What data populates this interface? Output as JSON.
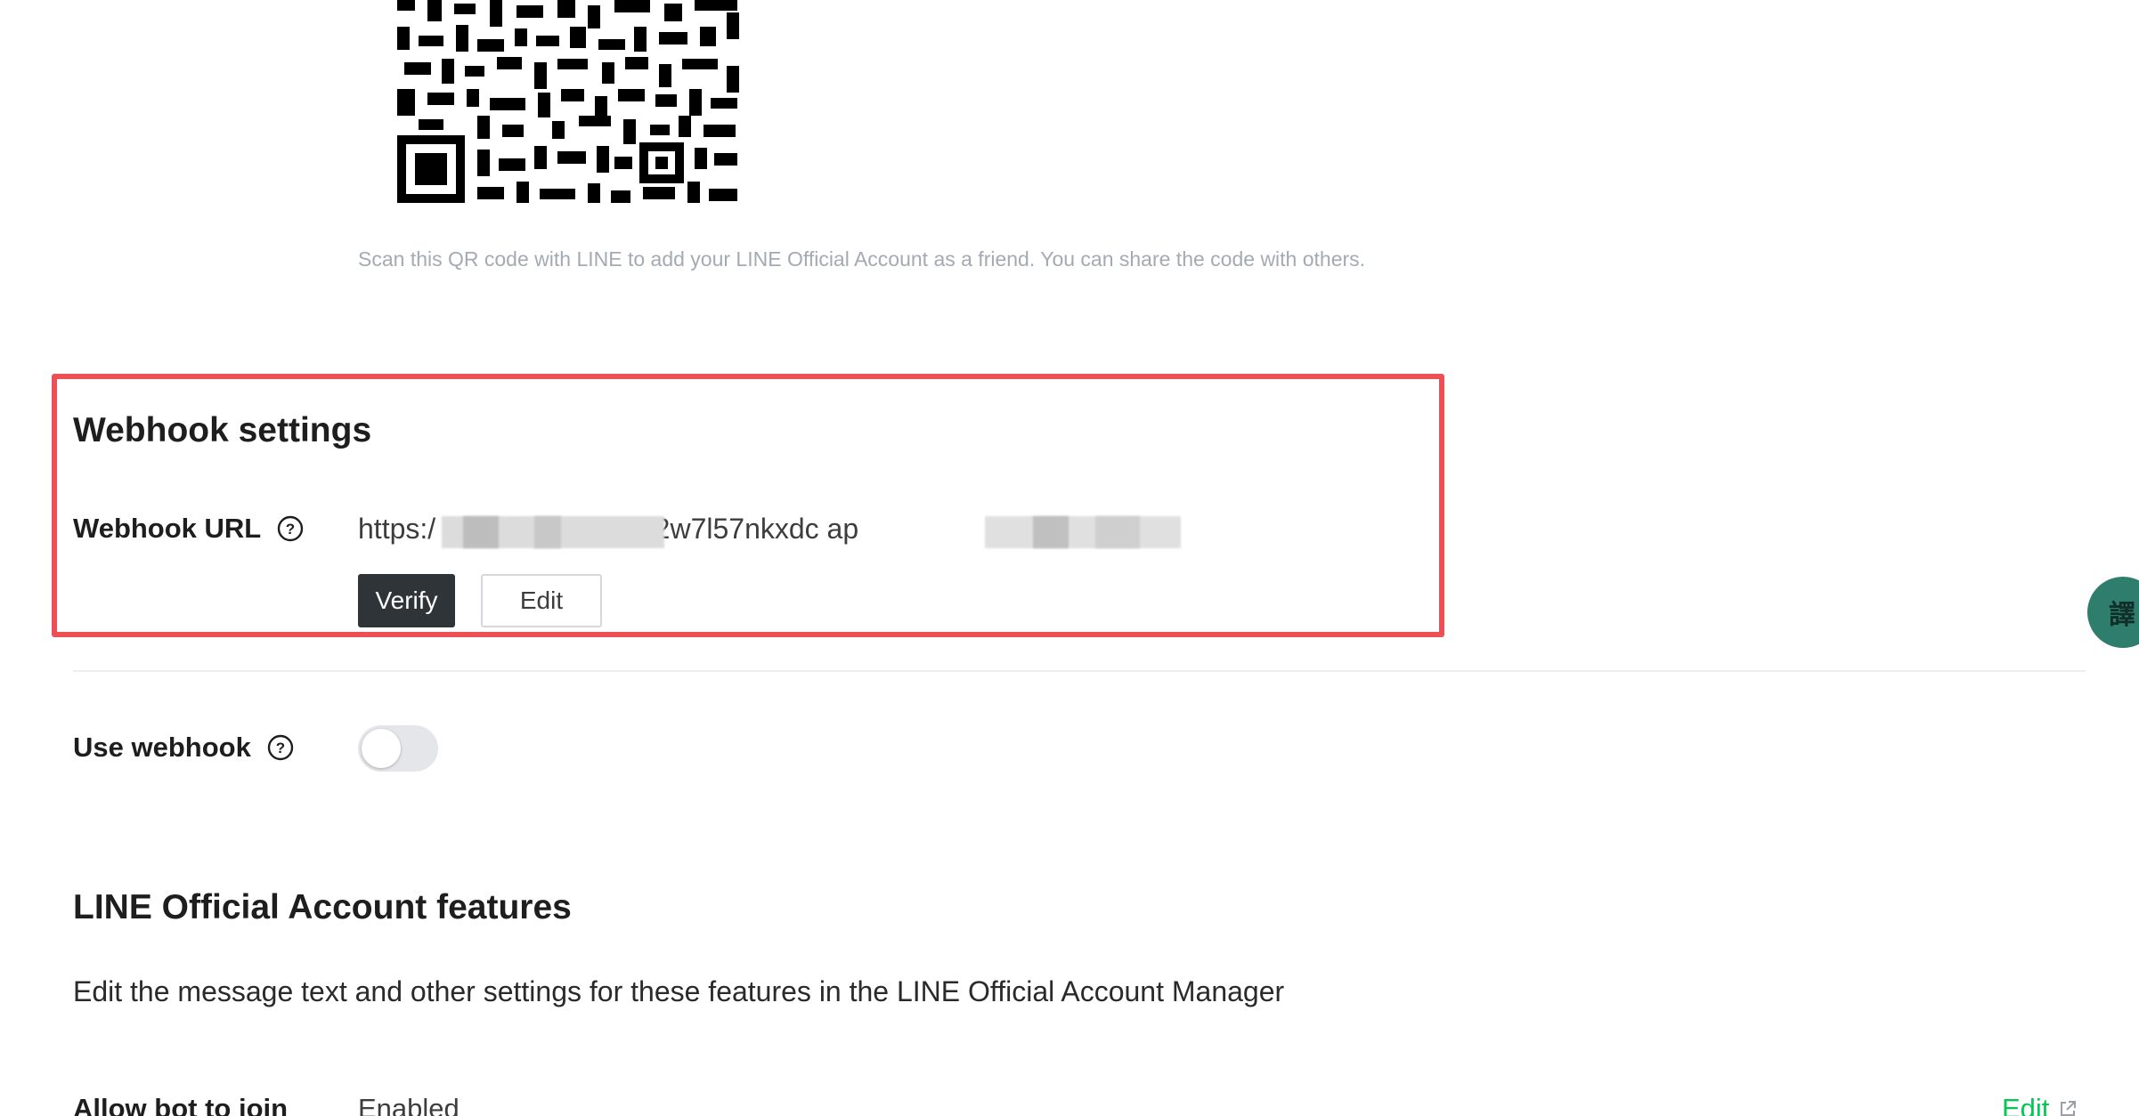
{
  "qr": {
    "caption": "Scan this QR code with LINE to add your LINE Official Account as a friend. You can share the code with others."
  },
  "webhook": {
    "title": "Webhook settings",
    "url_label": "Webhook URL",
    "url_value": "https:/                             .com/hp6437ux82w7l57nkxdc                   ap",
    "verify_label": "Verify",
    "edit_label": "Edit",
    "use_label": "Use webhook",
    "use_enabled": false
  },
  "features": {
    "title": "LINE Official Account features",
    "description": "Edit the message text and other settings for these features in the LINE Official Account Manager",
    "rows": [
      {
        "label": "Allow bot to join",
        "value": "Enabled",
        "action": "Edit"
      }
    ]
  },
  "translate_fab": {
    "label": "譯"
  },
  "colors": {
    "highlight": "#ec4f55",
    "primary_button": "#2f3439",
    "link_green": "#06c755",
    "fab": "#2f7d6d"
  }
}
